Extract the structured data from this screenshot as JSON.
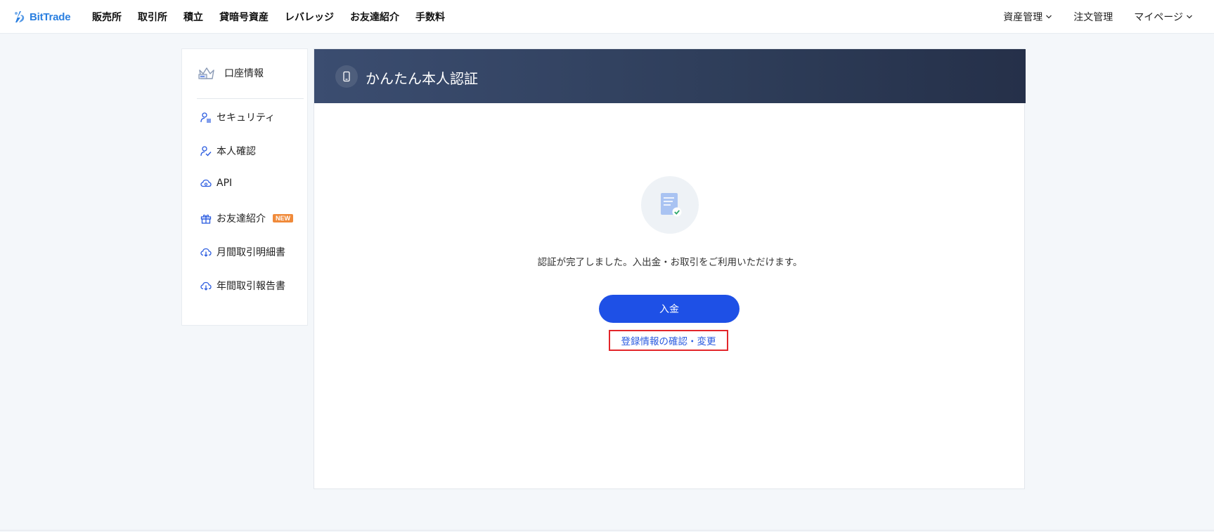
{
  "brand": {
    "name": "BitTrade",
    "color": "#2a7fe0"
  },
  "nav": {
    "items": [
      "販売所",
      "取引所",
      "積立",
      "貸暗号資産",
      "レバレッジ",
      "お友達紹介",
      "手数料"
    ],
    "right": [
      {
        "label": "資産管理",
        "icon": "chevron-down-icon"
      },
      {
        "label": "注文管理"
      },
      {
        "label": "マイページ",
        "icon": "chevron-down-icon"
      }
    ]
  },
  "sidebar": {
    "header": {
      "label": "口座情報",
      "icon": "crown-icon"
    },
    "items": [
      {
        "label": "セキュリティ",
        "icon": "user-security-icon"
      },
      {
        "label": "本人確認",
        "icon": "user-check-icon"
      },
      {
        "label": "API",
        "icon": "cloud-link-icon"
      },
      {
        "label": "お友達紹介",
        "icon": "gift-icon",
        "badge": "NEW"
      },
      {
        "label": "月間取引明細書",
        "icon": "cloud-download-icon"
      },
      {
        "label": "年間取引報告書",
        "icon": "cloud-download-icon"
      }
    ]
  },
  "main": {
    "title": "かんたん本人認証",
    "title_icon": "phone-icon",
    "status_icon": "document-check-icon",
    "message": "認証が完了しました。入出金・お取引をご利用いただけます。",
    "deposit_button": "入金",
    "edit_link": "登録情報の確認・変更"
  },
  "colors": {
    "accent": "#1e50e6",
    "header_bg": "#35456a",
    "highlight_border": "#e3262b",
    "new_badge": "#f08a3a"
  }
}
